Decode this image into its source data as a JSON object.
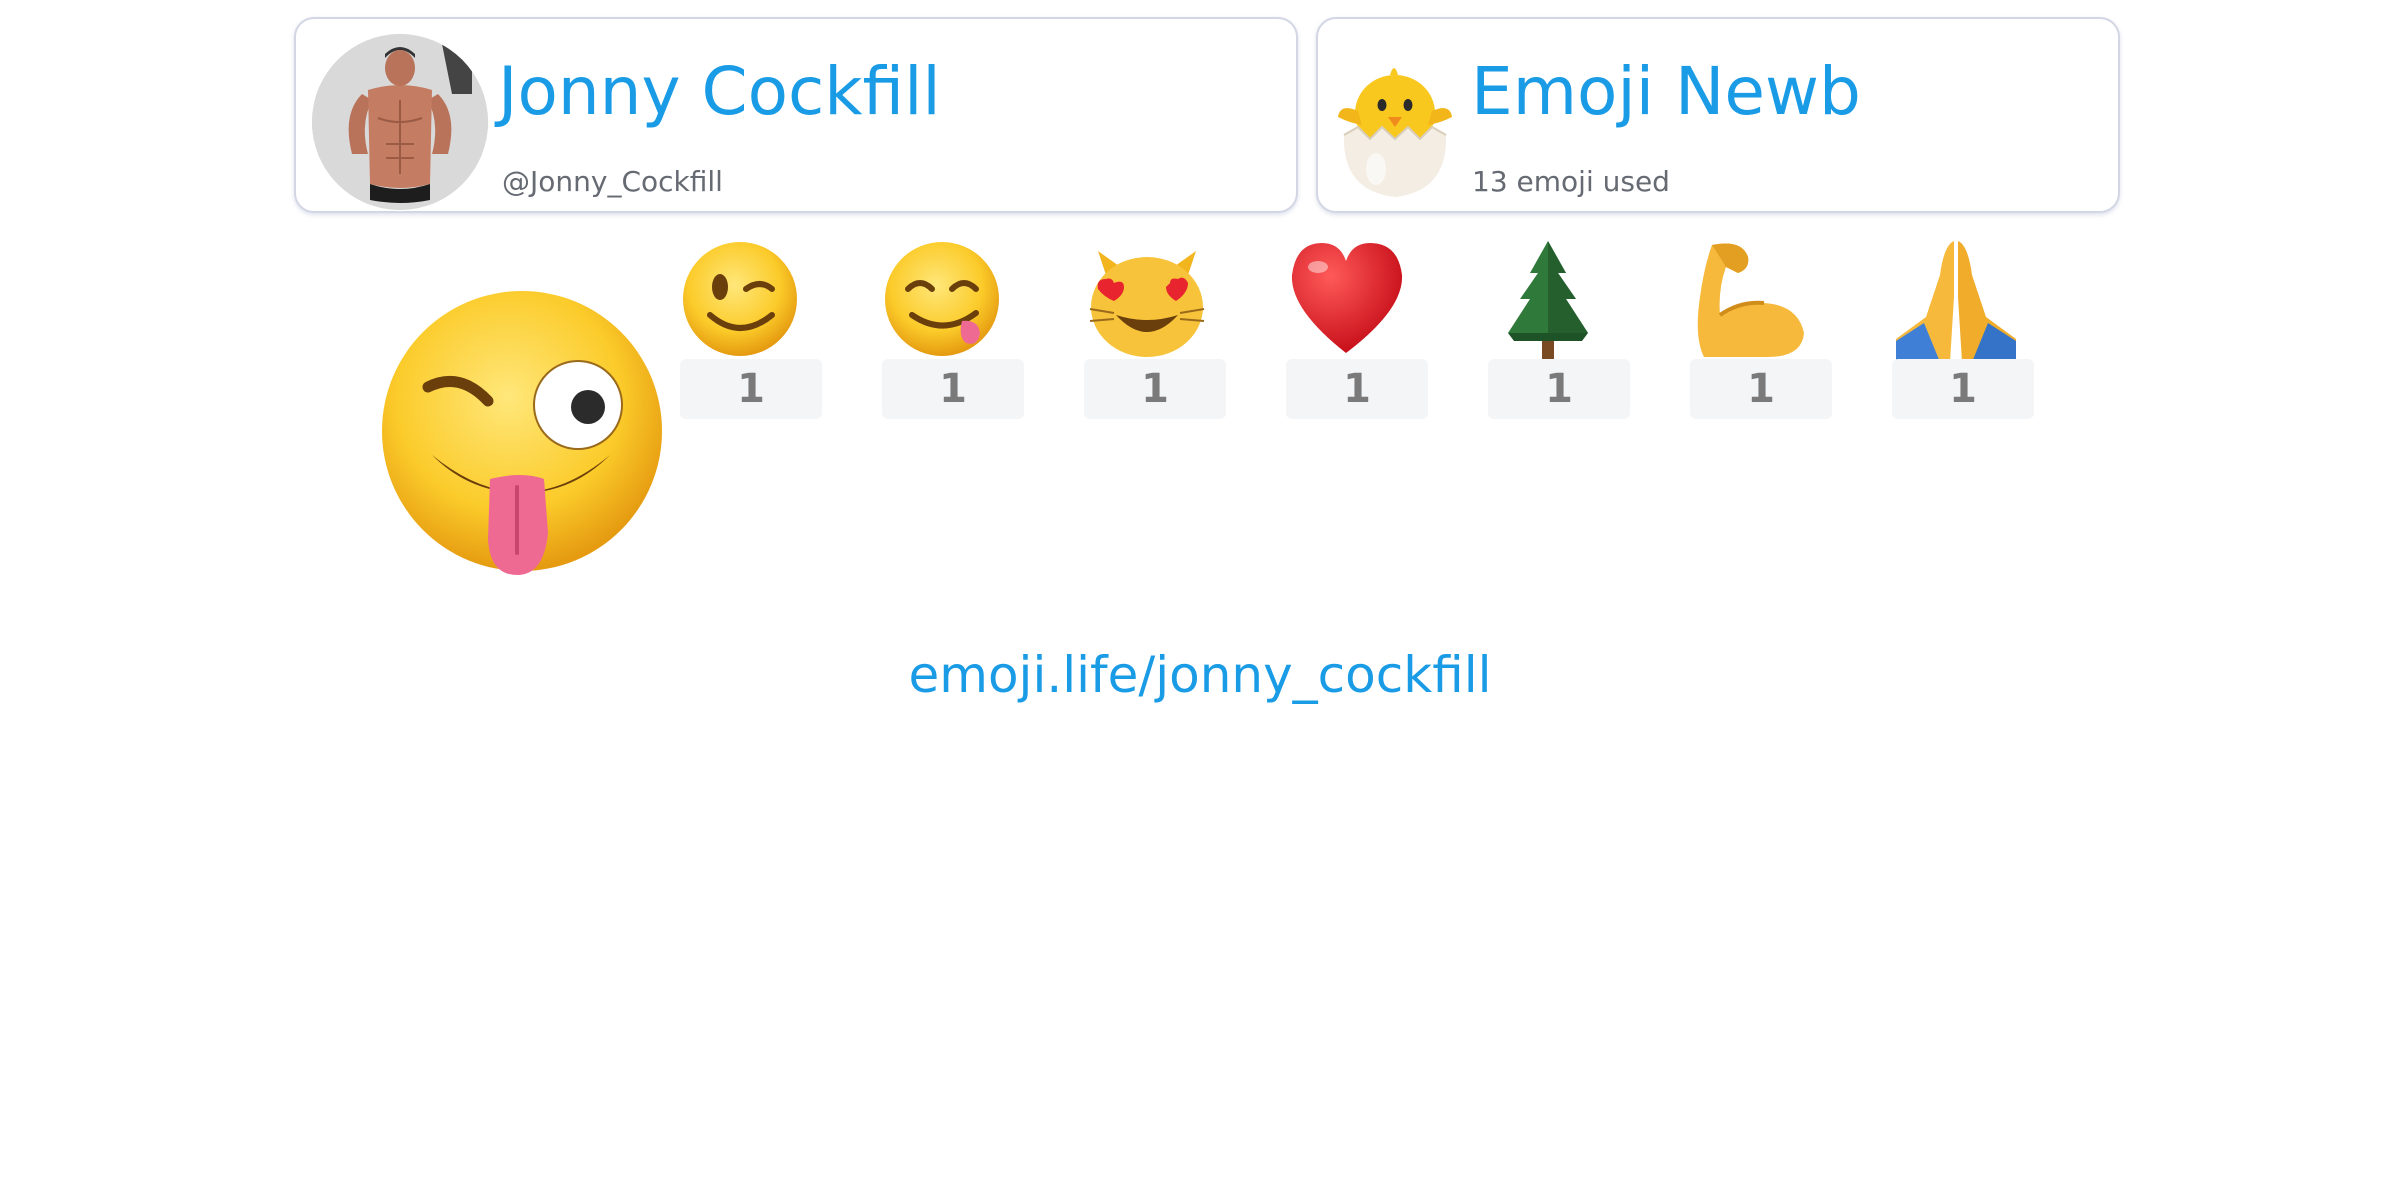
{
  "profile": {
    "name": "Jonny Cockfill",
    "handle": "@Jonny_Cockfill",
    "avatar_icon": "profile-photo"
  },
  "rank": {
    "title": "Emoji Newb",
    "subtitle": "13 emoji used",
    "icon": "hatching-chick-icon"
  },
  "top_emoji": {
    "icon": "winking-face-with-tongue-icon"
  },
  "emoji_list": [
    {
      "icon": "winking-face-icon",
      "count": "1"
    },
    {
      "icon": "face-savoring-food-icon",
      "count": "1"
    },
    {
      "icon": "smiling-cat-heart-eyes-icon",
      "count": "1"
    },
    {
      "icon": "red-heart-icon",
      "count": "1"
    },
    {
      "icon": "evergreen-tree-icon",
      "count": "1"
    },
    {
      "icon": "flexed-biceps-icon",
      "count": "1"
    },
    {
      "icon": "folded-hands-icon",
      "count": "1"
    }
  ],
  "footer": {
    "link": "emoji.life/jonny_cockfill"
  },
  "colors": {
    "accent": "#1a9be6",
    "muted_text": "#666a72",
    "card_border": "#d3d6e4",
    "count_bg": "#f4f5f7",
    "count_text": "#7a7a7a"
  }
}
